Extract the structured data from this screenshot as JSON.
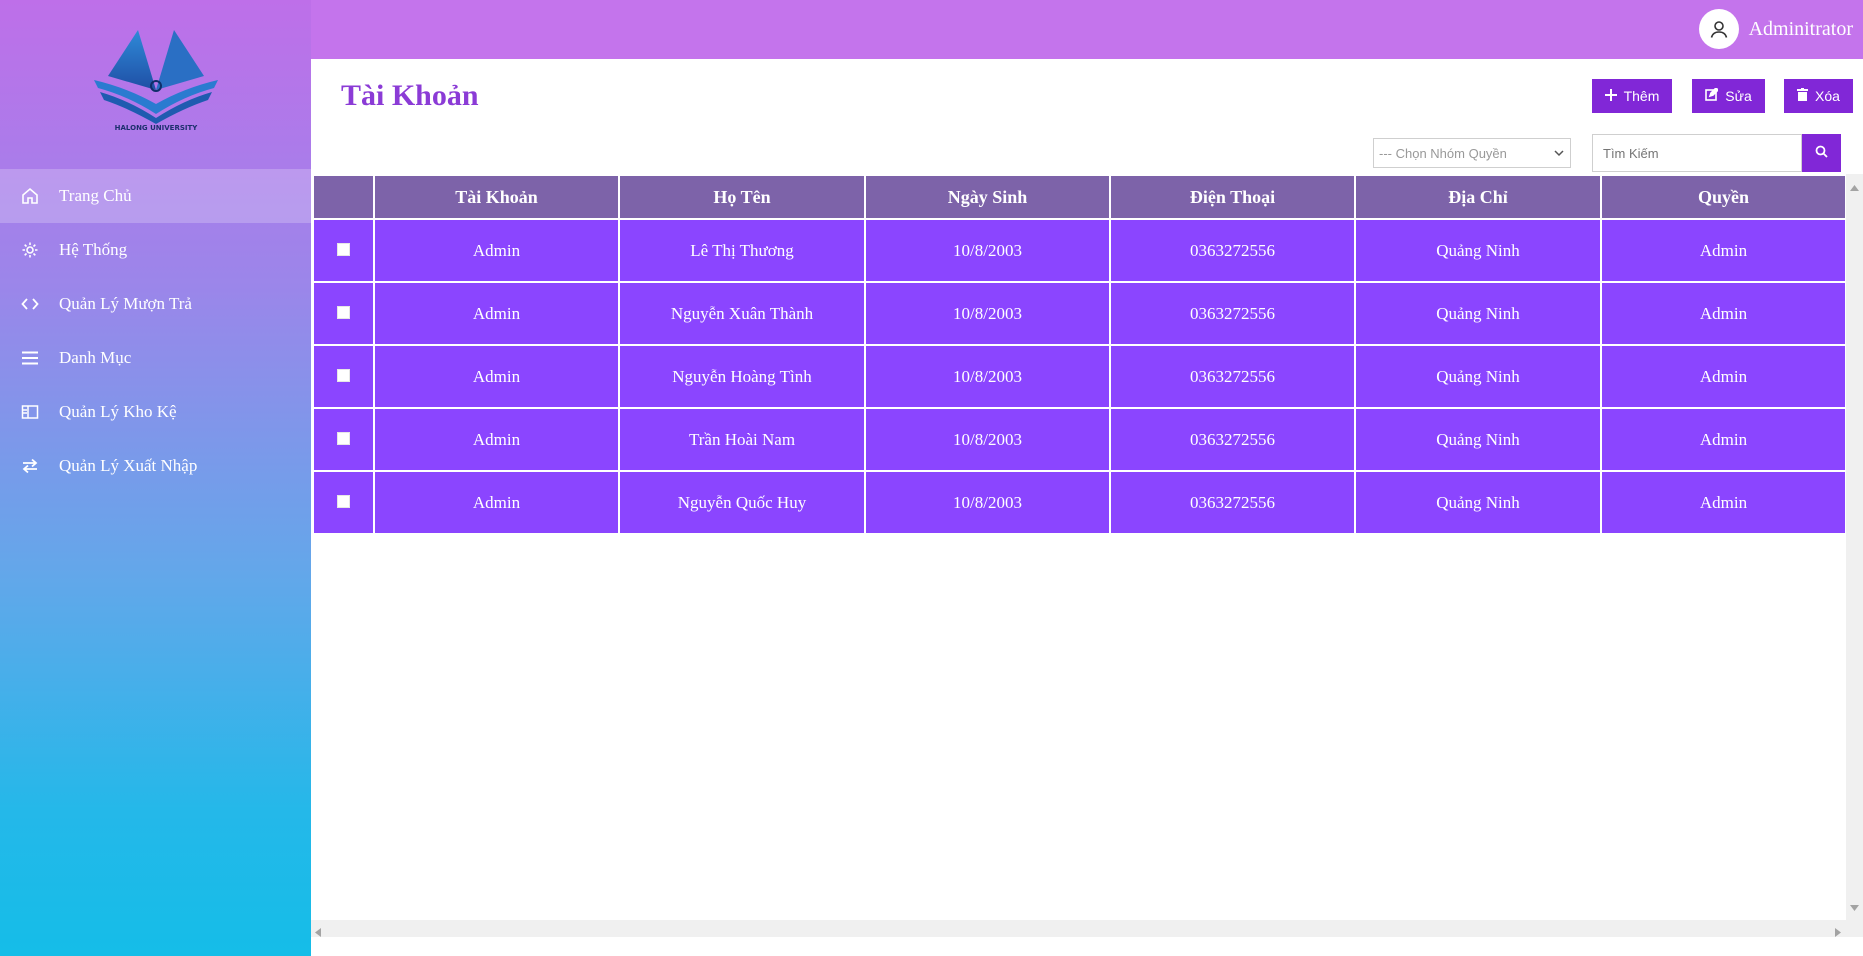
{
  "sidebar": {
    "logo_text": "HALONG UNIVERSITY",
    "items": [
      {
        "label": "Trang Chủ",
        "icon": "home-icon",
        "active": true
      },
      {
        "label": "Hệ Thống",
        "icon": "gear-icon"
      },
      {
        "label": "Quản Lý Mượn Trả",
        "icon": "code-icon"
      },
      {
        "label": "Danh Mục",
        "icon": "menu-icon"
      },
      {
        "label": "Quản Lý Kho Kệ",
        "icon": "shelf-icon"
      },
      {
        "label": "Quản Lý Xuất Nhập",
        "icon": "exchange-icon"
      }
    ]
  },
  "header": {
    "user_name": "Adminitrator",
    "avatar_icon": "user-icon"
  },
  "page": {
    "title": "Tài Khoản",
    "buttons": {
      "add": "Thêm",
      "edit": "Sửa",
      "delete": "Xóa"
    },
    "role_select": {
      "selected": "--- Chọn Nhóm Quyền"
    },
    "search": {
      "placeholder": "Tìm Kiếm"
    }
  },
  "table": {
    "headers": [
      "",
      "Tài Khoản",
      "Họ Tên",
      "Ngày Sinh",
      "Điện Thoại",
      "Địa Chỉ",
      "Quyền"
    ],
    "rows": [
      {
        "account": "Admin",
        "name": "Lê Thị Thương",
        "dob": "10/8/2003",
        "phone": "0363272556",
        "address": "Quảng Ninh",
        "role": "Admin"
      },
      {
        "account": "Admin",
        "name": "Nguyễn Xuân Thành",
        "dob": "10/8/2003",
        "phone": "0363272556",
        "address": "Quảng Ninh",
        "role": "Admin"
      },
      {
        "account": "Admin",
        "name": "Nguyễn Hoàng Tình",
        "dob": "10/8/2003",
        "phone": "0363272556",
        "address": "Quảng Ninh",
        "role": "Admin"
      },
      {
        "account": "Admin",
        "name": "Trần Hoài Nam",
        "dob": "10/8/2003",
        "phone": "0363272556",
        "address": "Quảng Ninh",
        "role": "Admin"
      },
      {
        "account": "Admin",
        "name": "Nguyễn Quốc Huy",
        "dob": "10/8/2003",
        "phone": "0363272556",
        "address": "Quảng Ninh",
        "role": "Admin"
      }
    ]
  },
  "colors": {
    "accent": "#8127d7",
    "title": "#8b3bd6",
    "topbar": "#c474ec",
    "header_cell": "#7d63a9",
    "row_cell": "#8b45ff"
  }
}
